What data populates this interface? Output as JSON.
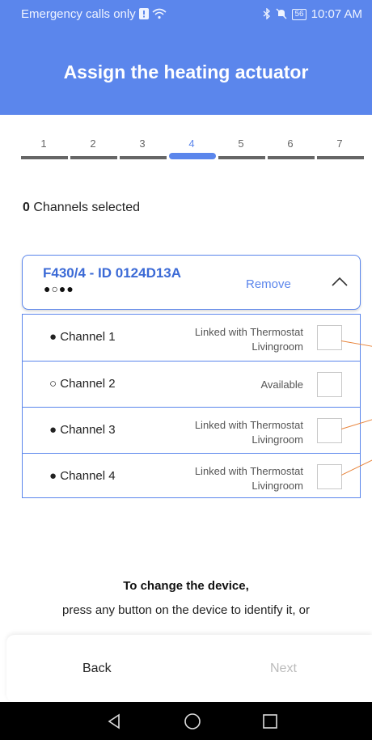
{
  "status_bar": {
    "left_text": "Emergency calls only",
    "battery": "56",
    "time": "10:07 AM"
  },
  "header": {
    "title": "Assign the heating actuator"
  },
  "stepper": {
    "steps": [
      "1",
      "2",
      "3",
      "4",
      "5",
      "6",
      "7"
    ],
    "active_index": 3
  },
  "selection": {
    "count": "0",
    "label": "Channels selected"
  },
  "device": {
    "name": "F430/4 - ID 0124D13A",
    "channel_dots": "●○●●",
    "remove_label": "Remove"
  },
  "channels": [
    {
      "bullet": "●",
      "label": "Channel 1",
      "status_line1": "Linked with Thermostat",
      "status_line2": "Livingroom"
    },
    {
      "bullet": "○",
      "label": "Channel 2",
      "status_line1": "Available",
      "status_line2": ""
    },
    {
      "bullet": "●",
      "label": "Channel 3",
      "status_line1": "Linked with Thermostat",
      "status_line2": "Livingroom"
    },
    {
      "bullet": "●",
      "label": "Channel 4",
      "status_line1": "Linked with Thermostat",
      "status_line2": "Livingroom"
    }
  ],
  "instructions": {
    "title": "To change the device,",
    "subtitle": "press any button on the device to identify it, or"
  },
  "actions": {
    "back_label": "Back",
    "next_label": "Next"
  },
  "colors": {
    "accent": "#5b86ec",
    "annotation": "#e8833a"
  }
}
